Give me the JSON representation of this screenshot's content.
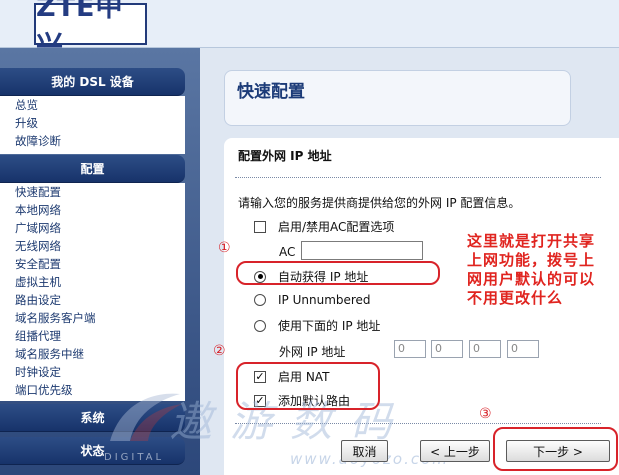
{
  "header": {
    "logo_text": "ZTE中兴"
  },
  "sidebar": {
    "group1": {
      "title": "我的 DSL 设备",
      "items": [
        "总览",
        "升级",
        "故障诊断"
      ]
    },
    "group2": {
      "title": "配置",
      "items": [
        "快速配置",
        "本地网络",
        "广域网络",
        "无线网络",
        "安全配置",
        "虚拟主机",
        "路由设定",
        "域名服务客户端",
        "组播代理",
        "域名服务中继",
        "时钟设定",
        "端口优先级"
      ]
    },
    "group3": {
      "title": "系统"
    },
    "group4": {
      "title": "状态"
    },
    "watermark_digital": "DIGITAL"
  },
  "main": {
    "page_title": "快速配置",
    "section_title": "配置外网 IP 地址",
    "description": "请输入您的服务提供商提供给您的外网 IP 配置信息。",
    "ac_toggle_label": "启用/禁用AC配置选项",
    "ac_label": "AC",
    "ac_value": "",
    "radio_auto": "自动获得 IP 地址",
    "radio_unnumbered": "IP Unnumbered",
    "radio_manual": "使用下面的 IP 地址",
    "wan_ip_label": "外网 IP 地址",
    "ip_octets": [
      "0",
      "0",
      "0",
      "0"
    ],
    "nat_label": "启用 NAT",
    "default_route_label": "添加默认路由",
    "buttons": {
      "cancel": "取消",
      "back": "< 上一步",
      "next": "下一步 >"
    }
  },
  "annotations": {
    "num1": "①",
    "num2": "②",
    "num3": "③",
    "note": "这里就是打开共享上网功能，拨号上网用户默认的可以不用更改什么",
    "color": "#d8232a"
  },
  "watermark": {
    "text": "遨游数码",
    "url": "www.aoyozo.com"
  }
}
